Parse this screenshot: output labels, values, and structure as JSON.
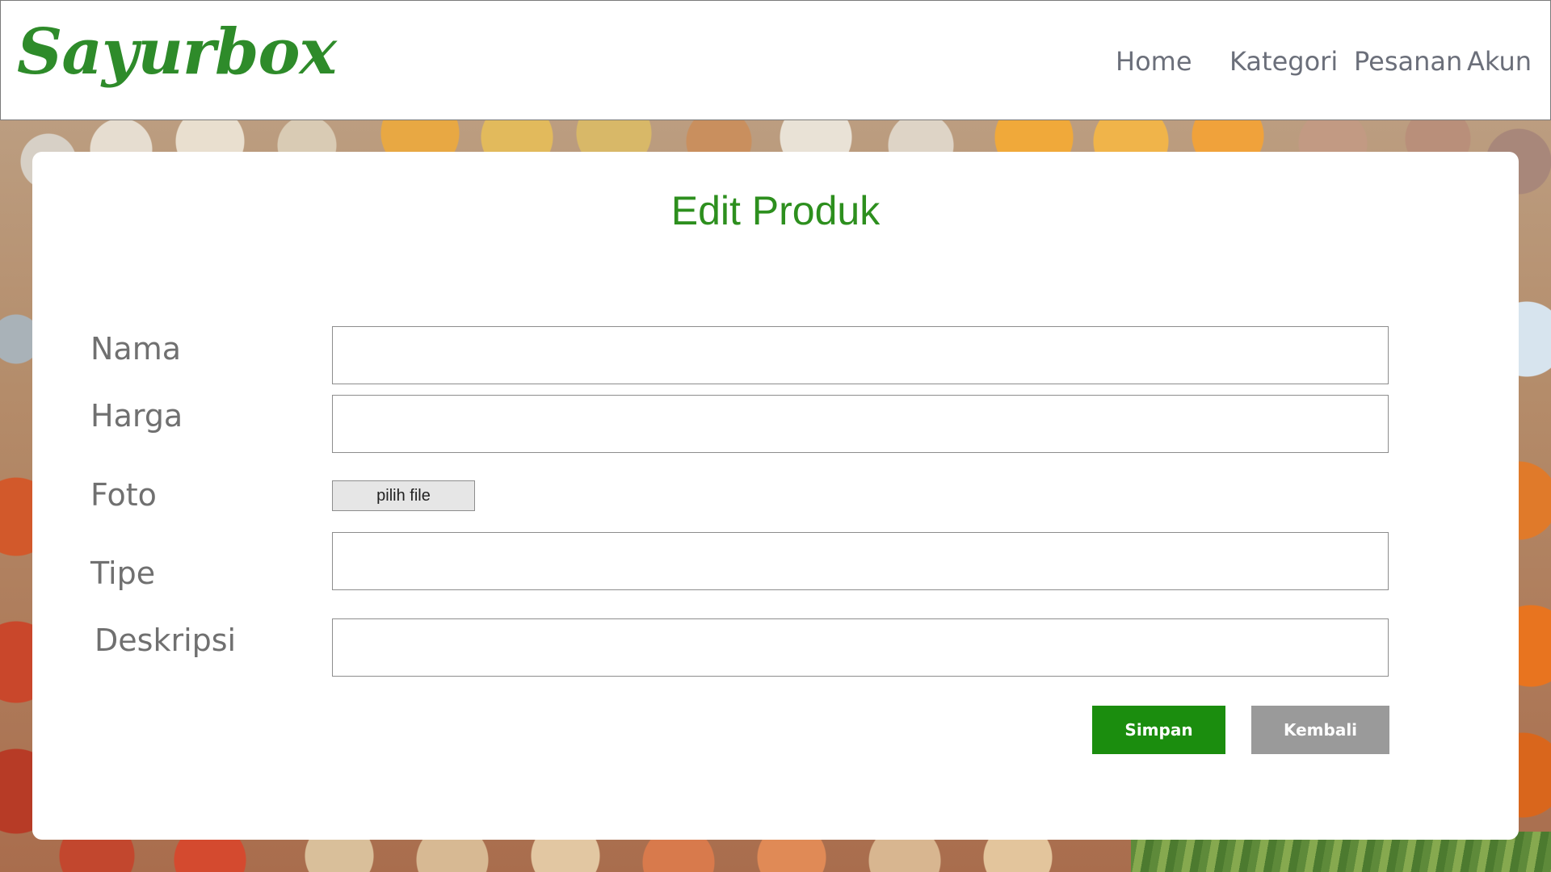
{
  "app": {
    "logo": "Sayurbox",
    "brand_color": "#2e8b2a"
  },
  "nav": {
    "items": [
      {
        "id": "home",
        "label": "Home"
      },
      {
        "id": "kategori",
        "label": "Kategori"
      },
      {
        "id": "pesanan",
        "label": "Pesanan"
      },
      {
        "id": "akun",
        "label": "Akun"
      }
    ]
  },
  "form": {
    "title": "Edit Produk",
    "title_color": "#2d8f1e",
    "fields": {
      "nama": {
        "label": "Nama",
        "value": ""
      },
      "harga": {
        "label": "Harga",
        "value": ""
      },
      "foto": {
        "label": "Foto",
        "button_label": "pilih file"
      },
      "tipe": {
        "label": "Tipe",
        "value": ""
      },
      "deskripsi": {
        "label": "Deskripsi",
        "value": ""
      }
    },
    "actions": {
      "save_label": "Simpan",
      "save_color": "#1b8d0e",
      "back_label": "Kembali",
      "back_color": "#9a9a9a"
    }
  }
}
